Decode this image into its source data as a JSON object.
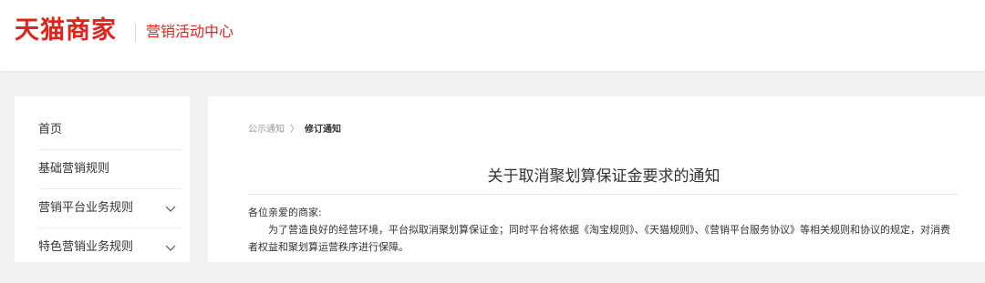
{
  "header": {
    "logo": "天猫商家",
    "subtitle": "营销活动中心"
  },
  "sidebar": {
    "items": [
      {
        "label": "首页",
        "has_chevron": false
      },
      {
        "label": "基础营销规则",
        "has_chevron": false
      },
      {
        "label": "营销平台业务规则",
        "has_chevron": true
      },
      {
        "label": "特色营销业务规则",
        "has_chevron": true
      }
    ]
  },
  "breadcrumb": {
    "parent": "公示通知",
    "separator": "〉",
    "current": "修订通知"
  },
  "article": {
    "title": "关于取消聚划算保证金要求的通知",
    "greeting": "各位亲爱的商家:",
    "paragraph": "为了营造良好的经营环境，平台拟取消聚划算保证金；同时平台将依据《淘宝规则》、《天猫规则》、《营销平台服务协议》等相关规则和协议的规定，对消费者权益和聚划算运营秩序进行保障。"
  },
  "colors": {
    "brand": "#e2231a",
    "page_bg": "#f2f2f2",
    "panel_bg": "#ffffff"
  }
}
